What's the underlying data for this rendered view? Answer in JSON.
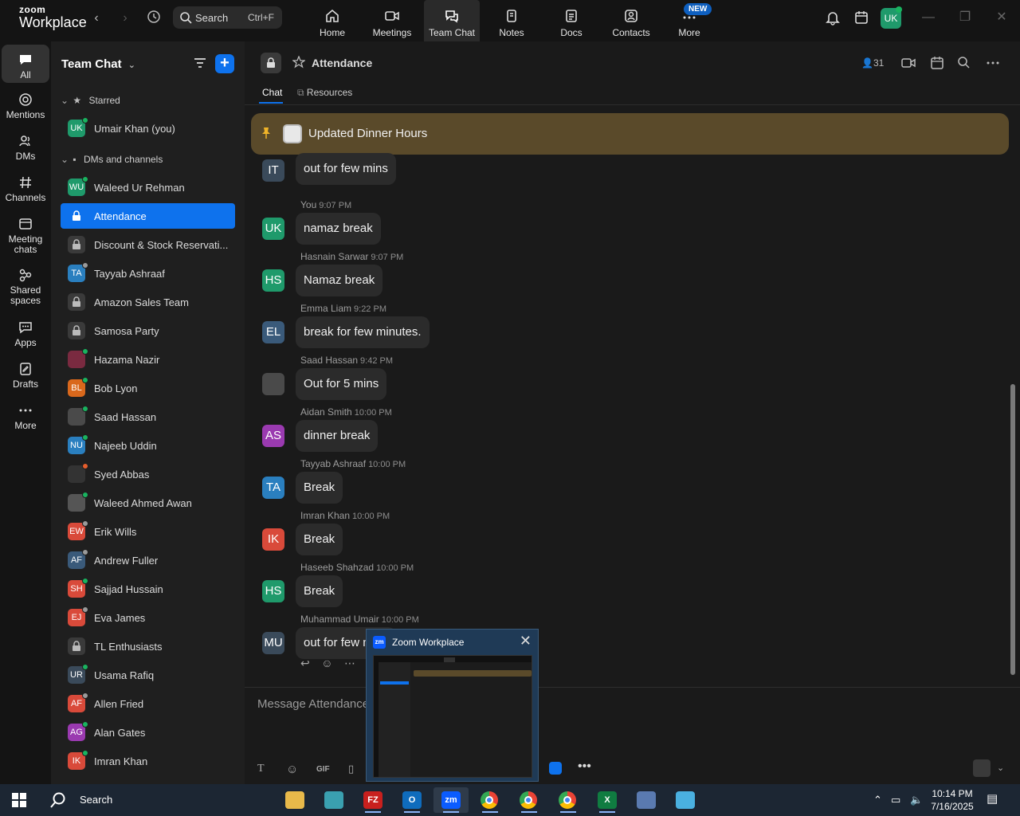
{
  "app": {
    "logo_top": "zoom",
    "logo_bottom": "Workplace",
    "search_label": "Search",
    "search_shortcut": "Ctrl+F",
    "nav": [
      {
        "label": "Home",
        "icon": "home-icon"
      },
      {
        "label": "Meetings",
        "icon": "video-icon"
      },
      {
        "label": "Team Chat",
        "icon": "chat-icon"
      },
      {
        "label": "Notes",
        "icon": "notes-icon"
      },
      {
        "label": "Docs",
        "icon": "docs-icon"
      },
      {
        "label": "Contacts",
        "icon": "contacts-icon"
      },
      {
        "label": "More",
        "icon": "more-icon"
      }
    ],
    "new_badge": "NEW",
    "user_initials": "UK"
  },
  "rail": [
    {
      "label": "All"
    },
    {
      "label": "Mentions"
    },
    {
      "label": "DMs"
    },
    {
      "label": "Channels"
    },
    {
      "label": "Meeting chats"
    },
    {
      "label": "Shared spaces"
    },
    {
      "label": "Apps"
    },
    {
      "label": "Drafts"
    },
    {
      "label": "More"
    }
  ],
  "sidebar": {
    "title": "Team Chat",
    "starred_label": "Starred",
    "dms_label": "DMs and channels",
    "starred": [
      {
        "name": "Umair Khan (you)",
        "initials": "UK",
        "color": "#1f9a6b",
        "status": "on"
      }
    ],
    "items": [
      {
        "name": "Waleed Ur Rehman",
        "initials": "WU",
        "color": "#1f9a6b",
        "status": "on",
        "type": "user"
      },
      {
        "name": "Attendance",
        "type": "channel",
        "active": true
      },
      {
        "name": "Discount & Stock Reservati...",
        "type": "channel"
      },
      {
        "name": "Tayyab Ashraaf",
        "initials": "TA",
        "color": "#2a7fbf",
        "status": "off",
        "type": "user"
      },
      {
        "name": "Amazon Sales Team",
        "type": "channel"
      },
      {
        "name": "Samosa Party",
        "type": "channel"
      },
      {
        "name": "Hazama Nazir",
        "initials": "",
        "color": "#7a2a40",
        "status": "on",
        "type": "user"
      },
      {
        "name": "Bob Lyon",
        "initials": "BL",
        "color": "#d9681c",
        "status": "on",
        "type": "user"
      },
      {
        "name": "Saad Hassan",
        "initials": "",
        "color": "#4a4a4a",
        "status": "on",
        "type": "user"
      },
      {
        "name": "Najeeb Uddin",
        "initials": "NU",
        "color": "#2a7fbf",
        "status": "on",
        "type": "user"
      },
      {
        "name": "Syed Abbas",
        "initials": "",
        "color": "#333333",
        "status": "busy",
        "type": "user"
      },
      {
        "name": "Waleed Ahmed Awan",
        "initials": "",
        "color": "#555555",
        "status": "on",
        "type": "user"
      },
      {
        "name": "Erik Wills",
        "initials": "EW",
        "color": "#d94a3a",
        "status": "off",
        "type": "user"
      },
      {
        "name": "Andrew Fuller",
        "initials": "AF",
        "color": "#3a5a7a",
        "status": "off",
        "type": "user"
      },
      {
        "name": "Sajjad Hussain",
        "initials": "SH",
        "color": "#d94a3a",
        "status": "on",
        "type": "user"
      },
      {
        "name": "Eva James",
        "initials": "EJ",
        "color": "#d94a3a",
        "status": "off",
        "type": "user"
      },
      {
        "name": "TL Enthusiasts",
        "type": "channel"
      },
      {
        "name": "Usama Rafiq",
        "initials": "UR",
        "color": "#3a4a5a",
        "status": "on",
        "type": "user"
      },
      {
        "name": "Allen Fried",
        "initials": "AF",
        "color": "#d94a3a",
        "status": "off",
        "type": "user"
      },
      {
        "name": "Alan Gates",
        "initials": "AG",
        "color": "#9a3ab0",
        "status": "on",
        "type": "user"
      },
      {
        "name": "Imran Khan",
        "initials": "IK",
        "color": "#d94a3a",
        "status": "on",
        "type": "user"
      }
    ]
  },
  "channel": {
    "name": "Attendance",
    "members": "31",
    "tabs": [
      "Chat",
      "Resources"
    ],
    "pinned": "Updated Dinner Hours",
    "composer_placeholder": "Message Attendance",
    "gif_label": "GIF"
  },
  "messages": [
    {
      "sender": "",
      "time": "",
      "text": "out for few mins",
      "initials": "IT",
      "color": "#3a4a5a"
    },
    {
      "sender": "You",
      "time": "9:07 PM",
      "text": "namaz break",
      "initials": "UK",
      "color": "#1f9a6b"
    },
    {
      "sender": "Hasnain Sarwar",
      "time": "9:07 PM",
      "text": "Namaz break",
      "initials": "HS",
      "color": "#1f9a6b"
    },
    {
      "sender": "Emma Liam",
      "time": "9:22 PM",
      "text": "break for few minutes.",
      "initials": "EL",
      "color": "#3a5a7a"
    },
    {
      "sender": "Saad Hassan",
      "time": "9:42 PM",
      "text": "Out for 5 mins",
      "initials": "",
      "color": "#4a4a4a"
    },
    {
      "sender": "Aidan Smith",
      "time": "10:00 PM",
      "text": "dinner break",
      "initials": "AS",
      "color": "#9a3ab0"
    },
    {
      "sender": "Tayyab Ashraaf",
      "time": "10:00 PM",
      "text": "Break",
      "initials": "TA",
      "color": "#2a7fbf"
    },
    {
      "sender": "Imran Khan",
      "time": "10:00 PM",
      "text": "Break",
      "initials": "IK",
      "color": "#d94a3a"
    },
    {
      "sender": "Haseeb Shahzad",
      "time": "10:00 PM",
      "text": "Break",
      "initials": "HS",
      "color": "#1f9a6b"
    },
    {
      "sender": "Muhammad Umair",
      "time": "10:00 PM",
      "text": "out for few mins",
      "initials": "MU",
      "color": "#3a4a5a"
    }
  ],
  "preview": {
    "title": "Zoom Workplace",
    "logo": "zm"
  },
  "taskbar": {
    "search": "Search",
    "time": "10:14 PM",
    "date": "7/16/2025",
    "apps": [
      {
        "name": "file-explorer",
        "label": "",
        "color": "#e8b94a"
      },
      {
        "name": "app-diamond",
        "label": "",
        "color": "#3aa0b0"
      },
      {
        "name": "filezilla",
        "label": "FZ",
        "color": "#c8201e"
      },
      {
        "name": "outlook",
        "label": "O",
        "color": "#0f6cbd"
      },
      {
        "name": "zoom",
        "label": "zm",
        "color": "#0b5cff"
      },
      {
        "name": "chrome-1",
        "label": "",
        "color": "#34a853"
      },
      {
        "name": "chrome-2",
        "label": "",
        "color": "#34a853"
      },
      {
        "name": "chrome-3",
        "label": "",
        "color": "#34a853"
      },
      {
        "name": "excel",
        "label": "X",
        "color": "#107c41"
      },
      {
        "name": "calculator",
        "label": "",
        "color": "#5a7ab0"
      },
      {
        "name": "app-blue",
        "label": "",
        "color": "#4ab0e0"
      }
    ]
  },
  "colors": {
    "accent": "#0e72ed",
    "pinned_bg": "#5a4a2a"
  }
}
